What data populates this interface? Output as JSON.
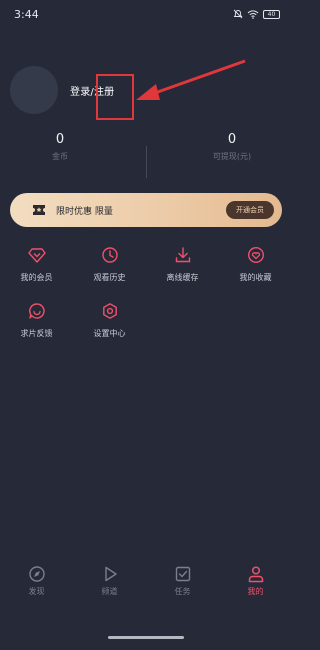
{
  "status_bar": {
    "time": "3:44",
    "battery": "40"
  },
  "profile": {
    "login_label": "登录/注册"
  },
  "stats": [
    {
      "value": "0",
      "label": "金币"
    },
    {
      "value": "0",
      "label": "可提现(元)"
    }
  ],
  "vip_banner": {
    "text": "限时优惠 限量",
    "button_label": "开通会员"
  },
  "menu_items": [
    {
      "label": "我的会员",
      "icon": "diamond-icon"
    },
    {
      "label": "观看历史",
      "icon": "clock-icon"
    },
    {
      "label": "离线缓存",
      "icon": "download-icon"
    },
    {
      "label": "我的收藏",
      "icon": "heart-icon"
    },
    {
      "label": "求片反馈",
      "icon": "feedback-icon"
    },
    {
      "label": "设置中心",
      "icon": "gear-icon"
    }
  ],
  "tabs": [
    {
      "label": "发现",
      "icon": "compass-icon",
      "active": false
    },
    {
      "label": "频道",
      "icon": "play-icon",
      "active": false
    },
    {
      "label": "任务",
      "icon": "task-icon",
      "active": false
    },
    {
      "label": "我的",
      "icon": "person-icon",
      "active": true
    }
  ],
  "colors": {
    "background": "#262a38",
    "accent": "#f0506a",
    "annotation": "#e0373b",
    "vip_gold": "#eccaa6"
  }
}
